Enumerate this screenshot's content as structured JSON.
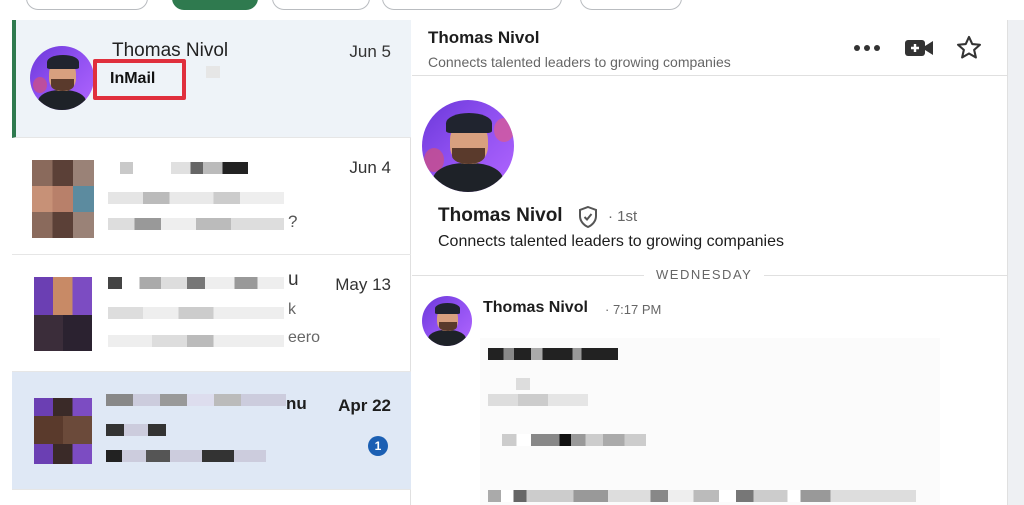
{
  "conversations": [
    {
      "name": "Thomas Nivol",
      "date": "Jun 5",
      "tag": "InMail",
      "selected": true
    },
    {
      "name": "",
      "date": "Jun 4",
      "snippet_tail": "?"
    },
    {
      "name_tail": "u",
      "date": "May 13",
      "snippet_tail": "k",
      "snippet_tail2": "eero"
    },
    {
      "name_tail": "nu",
      "date": "Apr 22",
      "unread_count": "1"
    }
  ],
  "header": {
    "name": "Thomas Nivol",
    "headline": "Connects talented leaders to growing companies",
    "icons": [
      "more-icon",
      "video-call-icon",
      "star-icon"
    ]
  },
  "profile": {
    "name": "Thomas Nivol",
    "degree": "· 1st",
    "headline": "Connects talented leaders to growing companies"
  },
  "day_divider": "WEDNESDAY",
  "message": {
    "sender": "Thomas Nivol",
    "time": "· 7:17 PM"
  },
  "colors": {
    "accent_green": "#2f7a4f",
    "highlight_red": "#e02f3d",
    "badge_blue": "#1b5fb3"
  }
}
